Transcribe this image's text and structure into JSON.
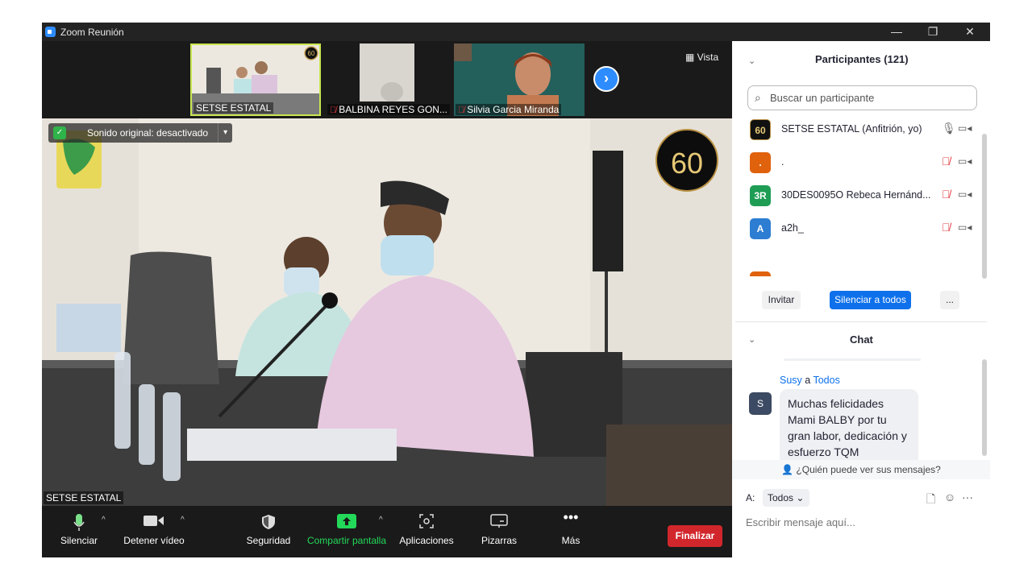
{
  "window": {
    "title": "Zoom Reunión",
    "minimize": "—",
    "restore": "❐",
    "close": "✕"
  },
  "strip": {
    "thumbs": [
      {
        "name": "SETSE ESTATAL",
        "muted": false
      },
      {
        "name": "BALBINA REYES GON...",
        "muted": true
      },
      {
        "name": "Silvia Garcia Miranda",
        "muted": true
      }
    ],
    "view_label": "Vista"
  },
  "main_video": {
    "original_sound": "Sonido original: desactivado",
    "speaker_label": "SETSE ESTATAL",
    "logo_text": "60"
  },
  "toolbar": {
    "mute": "Silenciar",
    "stop_video": "Detener vídeo",
    "security": "Seguridad",
    "share": "Compartir pantalla",
    "apps": "Aplicaciones",
    "whiteboards": "Pizarras",
    "more": "Más",
    "end": "Finalizar"
  },
  "participants": {
    "title": "Participantes (121)",
    "search_placeholder": "Buscar un participante",
    "list": [
      {
        "avatar": "60",
        "avatar_color": "#111111",
        "name": "SETSE ESTATAL (Anfitrión, yo)",
        "mic": "on"
      },
      {
        "avatar": ".",
        "avatar_color": "#e0620d",
        "name": ".",
        "mic": "off"
      },
      {
        "avatar": "3R",
        "avatar_color": "#1f9d55",
        "name": "30DES0095O  Rebeca Hernánd...",
        "mic": "off"
      },
      {
        "avatar": "A",
        "avatar_color": "#2d7dd2",
        "name": "a2h_",
        "mic": "off"
      }
    ],
    "invite": "Invitar",
    "mute_all": "Silenciar a todos",
    "more": "..."
  },
  "chat": {
    "title": "Chat",
    "sender": "Susy",
    "connector": "a",
    "recipient": "Todos",
    "avatar": "S",
    "message": "Muchas felicidades Mami BALBY por tu gran labor, dedicación y esfuerzo TQM",
    "who_can_see": "¿Quién puede ver sus mensajes?",
    "to_label": "A:",
    "to_value": "Todos",
    "input_placeholder": "Escribir mensaje aquí..."
  },
  "colors": {
    "accent": "#0e71eb",
    "end_red": "#d1272c",
    "share_green": "#23d959",
    "muted_red": "#e0383e"
  }
}
